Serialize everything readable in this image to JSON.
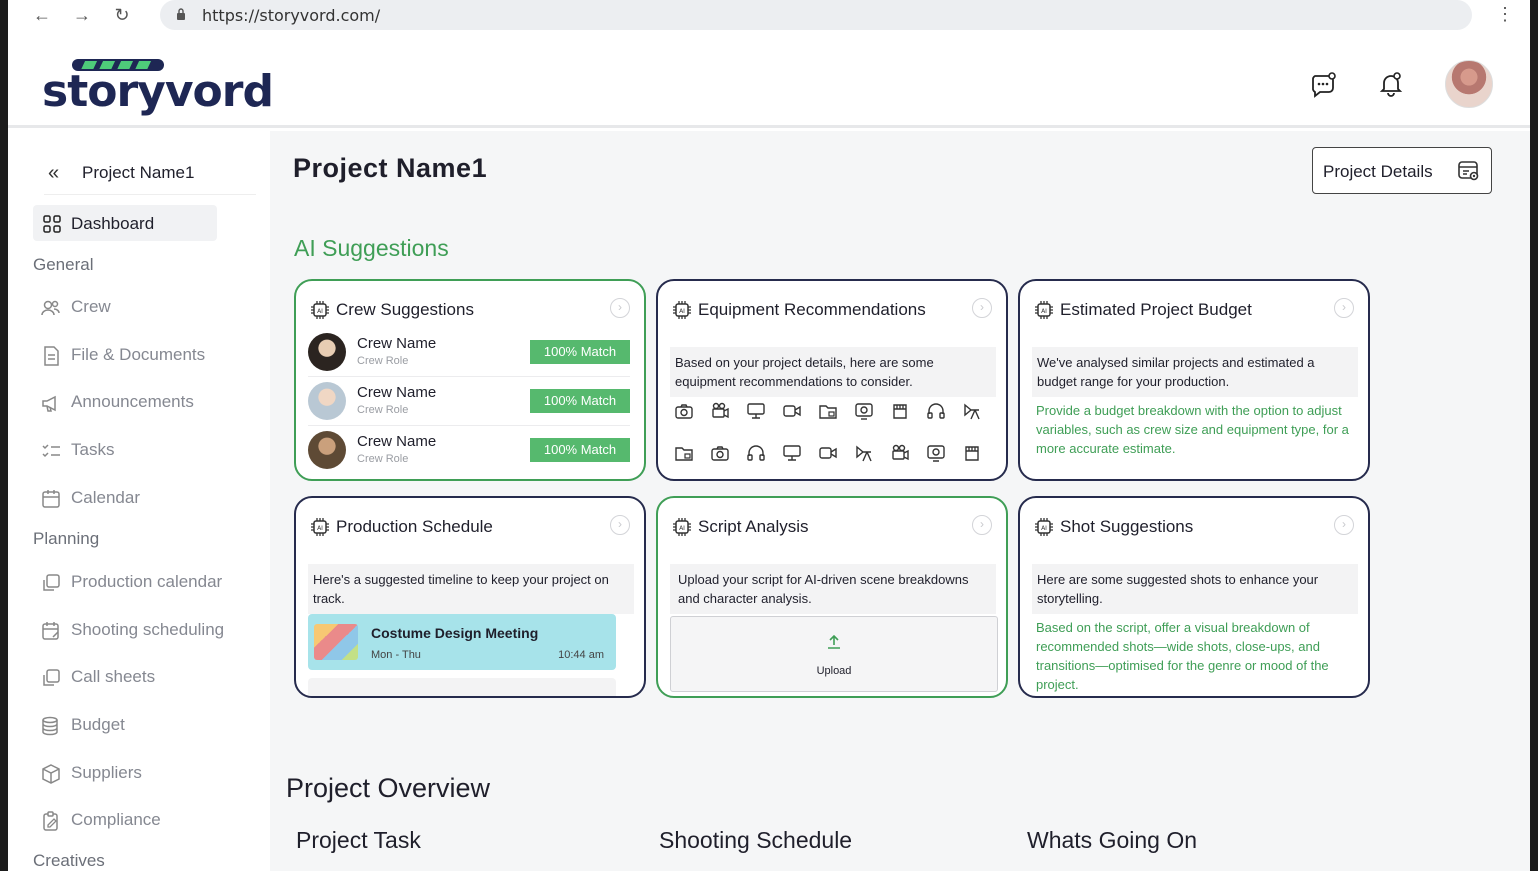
{
  "browser": {
    "url": "https://storyvord.com/",
    "back": "←",
    "forward": "→",
    "reload": "↻",
    "menu": "⋮"
  },
  "brand": {
    "logo_text": "storyvord"
  },
  "sidebar": {
    "project_name": "Project Name1",
    "collapse_glyph": "«",
    "dashboard_label": "Dashboard",
    "sections": {
      "general": "General",
      "planning": "Planning",
      "creatives": "Creatives"
    },
    "general_items": [
      {
        "label": "Crew",
        "icon": "crew-icon"
      },
      {
        "label": "File & Documents",
        "icon": "file-icon"
      },
      {
        "label": "Announcements",
        "icon": "megaphone-icon"
      },
      {
        "label": "Tasks",
        "icon": "checklist-icon"
      },
      {
        "label": "Calendar",
        "icon": "calendar-icon"
      }
    ],
    "planning_items": [
      {
        "label": "Production calendar",
        "icon": "copy-icon"
      },
      {
        "label": "Shooting scheduling",
        "icon": "calendar-edit-icon"
      },
      {
        "label": "Call sheets",
        "icon": "copy-icon"
      },
      {
        "label": "Budget",
        "icon": "coins-icon"
      },
      {
        "label": "Suppliers",
        "icon": "box-icon"
      },
      {
        "label": "Compliance",
        "icon": "clipboard-edit-icon"
      }
    ]
  },
  "main": {
    "title": "Project Name1",
    "project_details_label": "Project Details",
    "ai_title": "AI Suggestions",
    "cards": {
      "crew": {
        "title": "Crew Suggestions",
        "members": [
          {
            "name": "Crew Name",
            "role": "Crew Role",
            "match": "100% Match"
          },
          {
            "name": "Crew Name",
            "role": "Crew Role",
            "match": "100% Match"
          },
          {
            "name": "Crew Name",
            "role": "Crew Role",
            "match": "100% Match"
          }
        ]
      },
      "equipment": {
        "title": "Equipment Recommendations",
        "desc": "Based on your project details, here are some equipment recommendations to consider."
      },
      "budget": {
        "title": "Estimated Project Budget",
        "desc": "We've analysed similar projects and estimated a budget range for your production.",
        "note": "Provide a budget breakdown with the option to adjust variables, such as crew size and equipment type, for a more accurate estimate."
      },
      "schedule": {
        "title": "Production Schedule",
        "desc": "Here's a suggested timeline to keep your project on track.",
        "event": {
          "title": "Costume Design Meeting",
          "days": "Mon - Thu",
          "time": "10:44 am"
        }
      },
      "script": {
        "title": "Script Analysis",
        "desc": "Upload your script for AI-driven scene breakdowns and character analysis.",
        "upload_label": "Upload"
      },
      "shots": {
        "title": "Shot Suggestions",
        "desc": "Here are some suggested shots to enhance your storytelling.",
        "note": "Based on the script, offer a visual breakdown of recommended shots—wide shots, close-ups, and transitions—optimised for the genre or mood of the project."
      }
    },
    "overview": {
      "title": "Project Overview",
      "project_task": "Project Task",
      "shooting_schedule": "Shooting Schedule",
      "whats_going_on": "Whats Going On"
    }
  },
  "colors": {
    "brand_navy": "#1e2754",
    "accent_green": "#3f9e56",
    "match_green": "#56b96e",
    "event_teal": "#a7e3ea"
  }
}
